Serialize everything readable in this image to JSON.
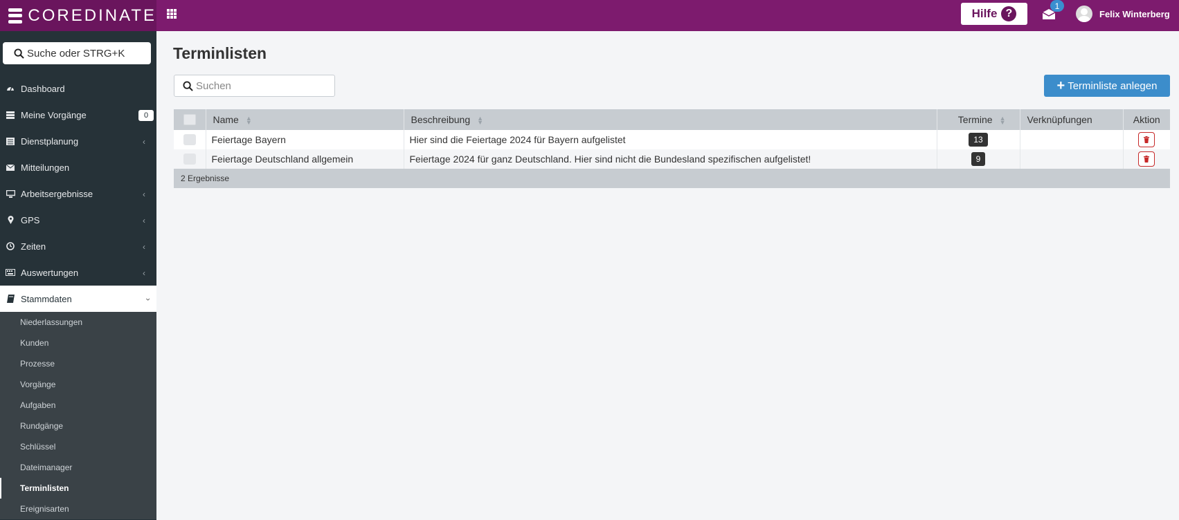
{
  "app": {
    "brand": "COREDINATE"
  },
  "topbar": {
    "help_label": "Hilfe",
    "help_icon": "?",
    "mail_count": "1",
    "user_name": "Felix Winterberg"
  },
  "sidebar": {
    "search_placeholder": "Suche oder STRG+K",
    "items": [
      {
        "label": "Dashboard",
        "icon": "dashboard-icon"
      },
      {
        "label": "Meine Vorgänge",
        "icon": "list-icon",
        "count": "0"
      },
      {
        "label": "Dienstplanung",
        "icon": "calendar-list-icon"
      },
      {
        "label": "Mitteilungen",
        "icon": "envelope-icon"
      },
      {
        "label": "Arbeitsergebnisse",
        "icon": "monitor-icon"
      },
      {
        "label": "GPS",
        "icon": "map-marker-icon"
      },
      {
        "label": "Zeiten",
        "icon": "clock-icon"
      },
      {
        "label": "Auswertungen",
        "icon": "keyboard-icon"
      },
      {
        "label": "Stammdaten",
        "icon": "book-icon"
      }
    ],
    "subitems": [
      "Niederlassungen",
      "Kunden",
      "Prozesse",
      "Vorgänge",
      "Aufgaben",
      "Rundgänge",
      "Schlüssel",
      "Dateimanager",
      "Terminlisten",
      "Ereignisarten"
    ]
  },
  "main": {
    "title": "Terminlisten",
    "search_placeholder": "Suchen",
    "create_label": "Terminliste anlegen",
    "table": {
      "headers": [
        "Name",
        "Beschreibung",
        "Termine",
        "Verknüpfungen",
        "Aktion"
      ],
      "rows": [
        {
          "name": "Feiertage Bayern",
          "description": "Hier sind die Feiertage 2024 für Bayern aufgelistet",
          "termine": "13",
          "links": ""
        },
        {
          "name": "Feiertage Deutschland allgemein",
          "description": "Feiertage 2024 für ganz Deutschland. Hier sind nicht die Bundesland spezifischen aufgelistet!",
          "termine": "9",
          "links": ""
        }
      ],
      "footer": "2 Ergebnisse"
    }
  },
  "colors": {
    "topbar": "#7d1b6e",
    "sidebar": "#263238",
    "primary": "#3c8dcb",
    "danger": "#c62828"
  }
}
